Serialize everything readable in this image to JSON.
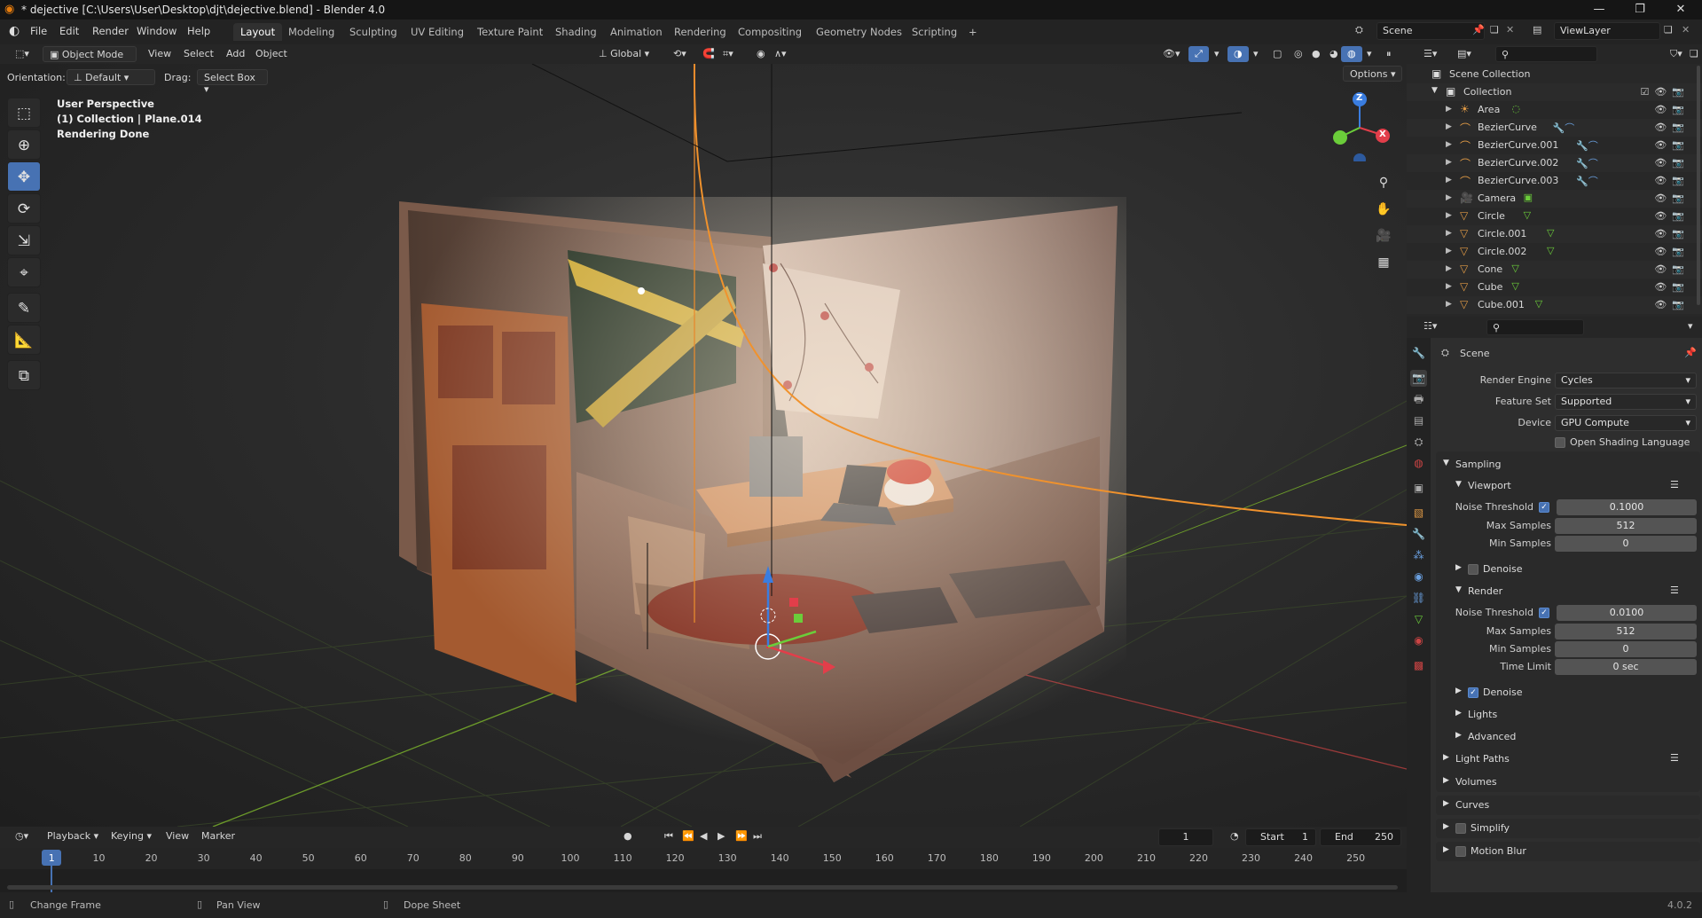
{
  "window": {
    "title": "* dejective [C:\\Users\\User\\Desktop\\djt\\dejective.blend] - Blender 4.0",
    "minimize": "—",
    "maximize": "❐",
    "close": "✕"
  },
  "menu": [
    "File",
    "Edit",
    "Render",
    "Window",
    "Help"
  ],
  "workspaces": [
    "Layout",
    "Modeling",
    "Sculpting",
    "UV Editing",
    "Texture Paint",
    "Shading",
    "Animation",
    "Rendering",
    "Compositing",
    "Geometry Nodes",
    "Scripting",
    "+"
  ],
  "active_workspace": "Layout",
  "scene_field": "Scene",
  "viewlayer_field": "ViewLayer",
  "viewport_header": {
    "mode": "Object Mode",
    "menus": [
      "View",
      "Select",
      "Add",
      "Object"
    ],
    "orientation_label": "Orientation:",
    "orientation_value": "Default",
    "drag_label": "Drag:",
    "drag_value": "Select Box",
    "transform_orientation": "Global",
    "options": "Options"
  },
  "viewport_overlay": {
    "line1": "User Perspective",
    "line2": "(1) Collection | Plane.014",
    "line3": "Rendering Done"
  },
  "gizmo": {
    "z": "Z",
    "x": "X"
  },
  "timeline": {
    "menus": [
      "Playback",
      "Keying",
      "View",
      "Marker"
    ],
    "current_frame": "1",
    "start_label": "Start",
    "start_value": "1",
    "end_label": "End",
    "end_value": "250",
    "ticks": [
      "1",
      "10",
      "20",
      "30",
      "40",
      "50",
      "60",
      "70",
      "80",
      "90",
      "100",
      "110",
      "120",
      "130",
      "140",
      "150",
      "160",
      "170",
      "180",
      "190",
      "200",
      "210",
      "220",
      "230",
      "240",
      "250"
    ]
  },
  "statusbar": {
    "left": "Change Frame",
    "middle": "Pan View",
    "right": "Dope Sheet",
    "version": "4.0.2"
  },
  "outliner": {
    "scene_collection": "Scene Collection",
    "collection": "Collection",
    "items": [
      {
        "name": "Area",
        "kind": "light"
      },
      {
        "name": "BezierCurve",
        "kind": "curve"
      },
      {
        "name": "BezierCurve.001",
        "kind": "curve"
      },
      {
        "name": "BezierCurve.002",
        "kind": "curve"
      },
      {
        "name": "BezierCurve.003",
        "kind": "curve"
      },
      {
        "name": "Camera",
        "kind": "camera"
      },
      {
        "name": "Circle",
        "kind": "mesh"
      },
      {
        "name": "Circle.001",
        "kind": "mesh"
      },
      {
        "name": "Circle.002",
        "kind": "mesh"
      },
      {
        "name": "Cone",
        "kind": "mesh"
      },
      {
        "name": "Cube",
        "kind": "mesh"
      },
      {
        "name": "Cube.001",
        "kind": "mesh"
      }
    ]
  },
  "properties": {
    "context": "Scene",
    "render_engine_label": "Render Engine",
    "render_engine": "Cycles",
    "feature_set_label": "Feature Set",
    "feature_set": "Supported",
    "device_label": "Device",
    "device": "GPU Compute",
    "osl": "Open Shading Language",
    "sampling": "Sampling",
    "viewport": "Viewport",
    "vp_noise_label": "Noise Threshold",
    "vp_noise": "0.1000",
    "vp_max_label": "Max Samples",
    "vp_max": "512",
    "vp_min_label": "Min Samples",
    "vp_min": "0",
    "vp_denoise": "Denoise",
    "render": "Render",
    "r_noise_label": "Noise Threshold",
    "r_noise": "0.0100",
    "r_max_label": "Max Samples",
    "r_max": "512",
    "r_min_label": "Min Samples",
    "r_min": "0",
    "r_time_label": "Time Limit",
    "r_time": "0 sec",
    "r_denoise": "Denoise",
    "lights": "Lights",
    "advanced": "Advanced",
    "light_paths": "Light Paths",
    "volumes": "Volumes",
    "curves": "Curves",
    "simplify": "Simplify",
    "motion_blur": "Motion Blur"
  }
}
